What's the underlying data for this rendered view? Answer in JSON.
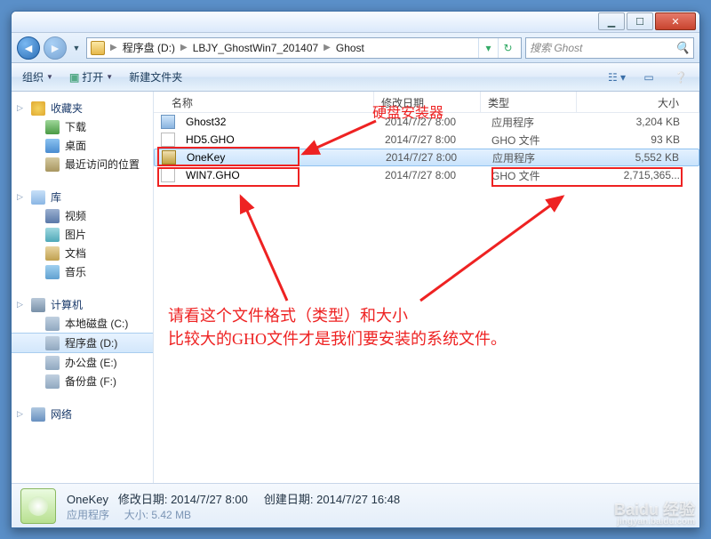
{
  "address": {
    "root_icon": "folder",
    "crumbs": [
      "程序盘 (D:)",
      "LBJY_GhostWin7_201407",
      "Ghost"
    ],
    "search_placeholder": "搜索 Ghost"
  },
  "cmdbar": {
    "organize": "组织",
    "open": "打开",
    "newfolder": "新建文件夹"
  },
  "sidebar": {
    "fav": "收藏夹",
    "fav_items": [
      "下载",
      "桌面",
      "最近访问的位置"
    ],
    "lib": "库",
    "lib_items": [
      "视频",
      "图片",
      "文档",
      "音乐"
    ],
    "comp": "计算机",
    "comp_items": [
      "本地磁盘 (C:)",
      "程序盘 (D:)",
      "办公盘 (E:)",
      "备份盘 (F:)"
    ],
    "net": "网络"
  },
  "columns": {
    "name": "名称",
    "date": "修改日期",
    "type": "类型",
    "size": "大小"
  },
  "files": [
    {
      "name": "Ghost32",
      "date": "2014/7/27 8:00",
      "type": "应用程序",
      "size": "3,204 KB"
    },
    {
      "name": "HD5.GHO",
      "date": "2014/7/27 8:00",
      "type": "GHO 文件",
      "size": "93 KB"
    },
    {
      "name": "OneKey",
      "date": "2014/7/27 8:00",
      "type": "应用程序",
      "size": "5,552 KB"
    },
    {
      "name": "WIN7.GHO",
      "date": "2014/7/27 8:00",
      "type": "GHO 文件",
      "size": "2,715,365..."
    }
  ],
  "annotations": {
    "a1": "硬盘安装器",
    "a2_line1": "请看这个文件格式（类型）和大小",
    "a2_line2": "比较大的GHO文件才是我们要安装的系统文件。"
  },
  "details": {
    "filename": "OneKey",
    "mod_label": "修改日期:",
    "mod_val": "2014/7/27 8:00",
    "create_label": "创建日期:",
    "create_val": "2014/7/27 16:48",
    "type_label": "应用程序",
    "size_label": "大小:",
    "size_val": "5.42 MB"
  },
  "watermark": {
    "big": "Baidu 经验",
    "small": "jingyan.baidu.com"
  }
}
